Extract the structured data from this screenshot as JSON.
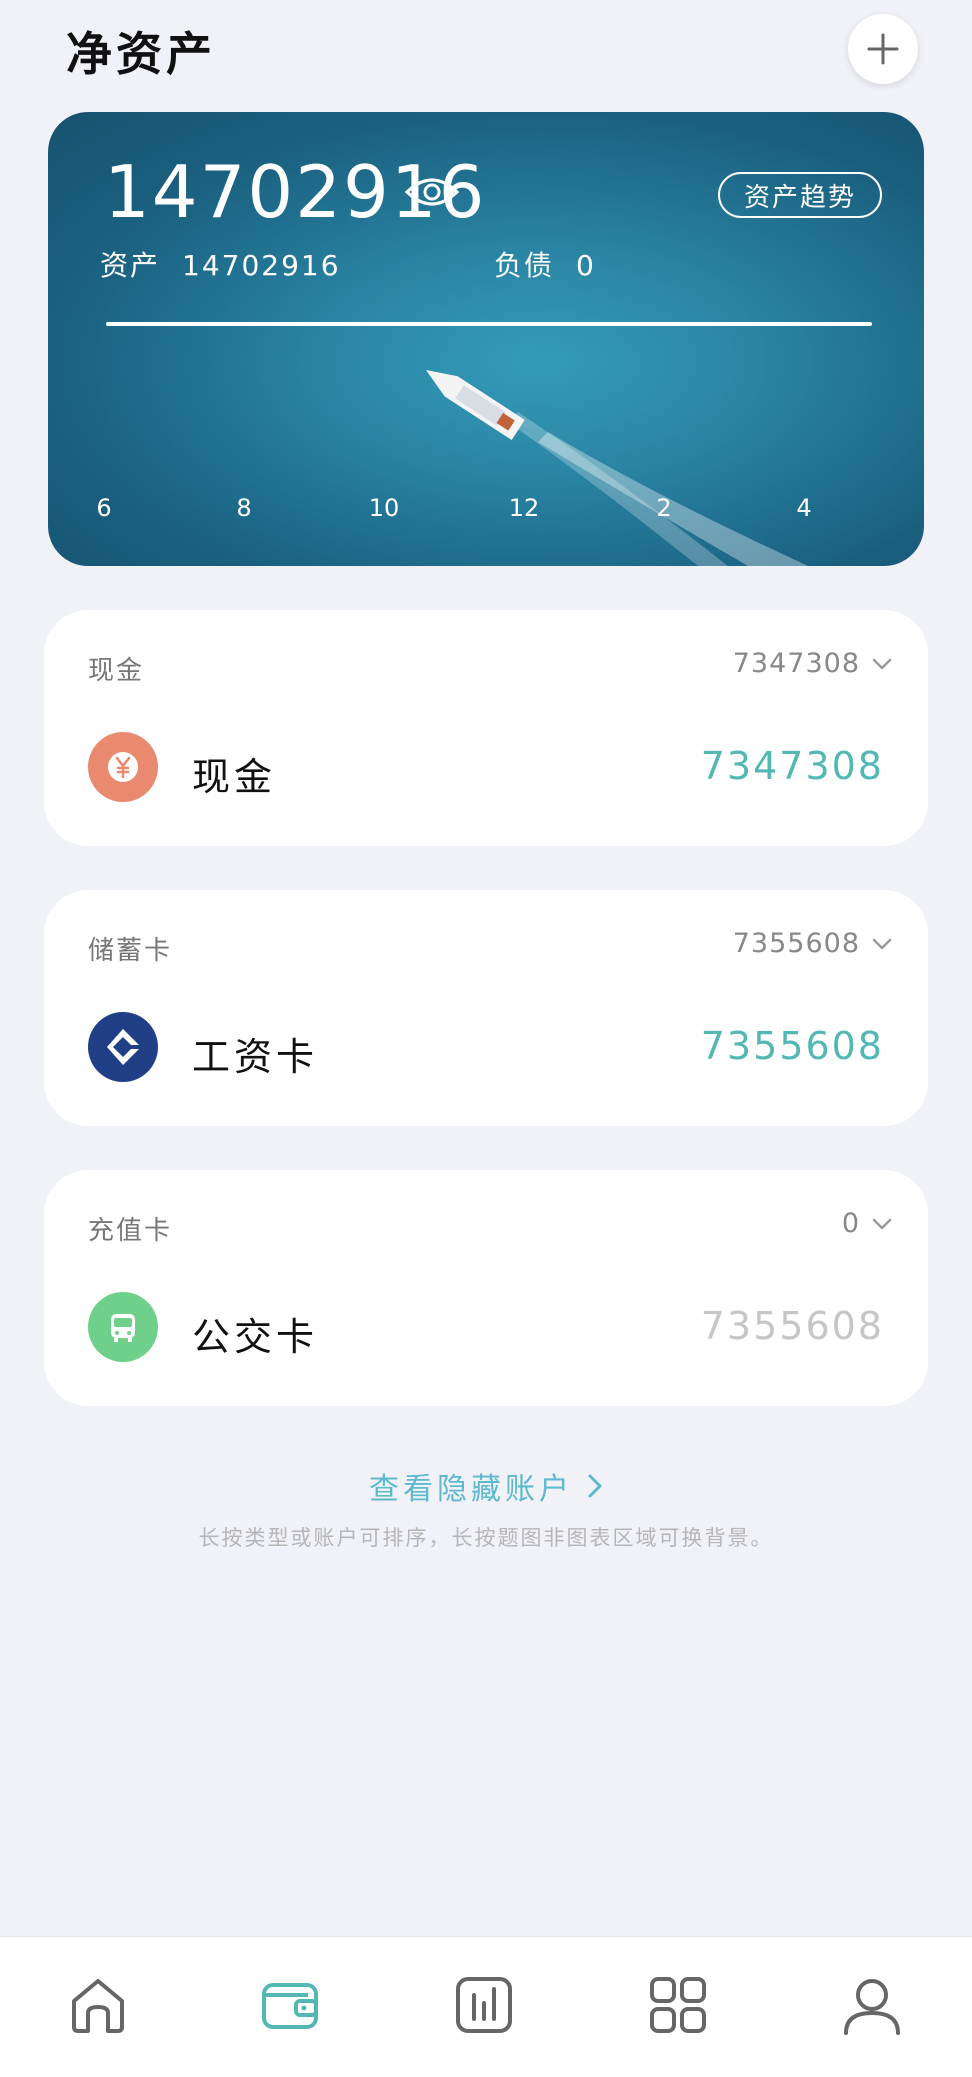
{
  "header": {
    "title": "净资产"
  },
  "summary": {
    "net_worth": "14702916",
    "assets_label": "资产",
    "assets_value": "14702916",
    "debt_label": "负债",
    "debt_value": "0",
    "trend_button": "资产趋势",
    "axis_labels": [
      "6",
      "8",
      "10",
      "12",
      "2",
      "4"
    ]
  },
  "groups": [
    {
      "category": "现金",
      "total": "7347308",
      "account": {
        "name": "现金",
        "amount": "7347308",
        "icon": "yen-icon",
        "color": "#e98a70"
      }
    },
    {
      "category": "储蓄卡",
      "total": "7355608",
      "account": {
        "name": "工资卡",
        "amount": "7355608",
        "icon": "ccb-bank-icon",
        "color": "#213f86"
      }
    },
    {
      "category": "充值卡",
      "total": "0",
      "account": {
        "name": "公交卡",
        "amount": "7355608",
        "icon": "bus-icon",
        "color": "#6fd08c"
      }
    }
  ],
  "footer": {
    "hidden_accounts_label": "查看隐藏账户",
    "hint": "长按类型或账户可排序，长按题图非图表区域可换背景。"
  },
  "nav": [
    {
      "icon": "home-icon",
      "active": false
    },
    {
      "icon": "wallet-icon",
      "active": true
    },
    {
      "icon": "chart-icon",
      "active": false
    },
    {
      "icon": "grid-icon",
      "active": false
    },
    {
      "icon": "profile-icon",
      "active": false
    }
  ],
  "colors": {
    "accent": "#53b8b3",
    "link": "#5fb9ce",
    "background": "#f1f2f7"
  }
}
